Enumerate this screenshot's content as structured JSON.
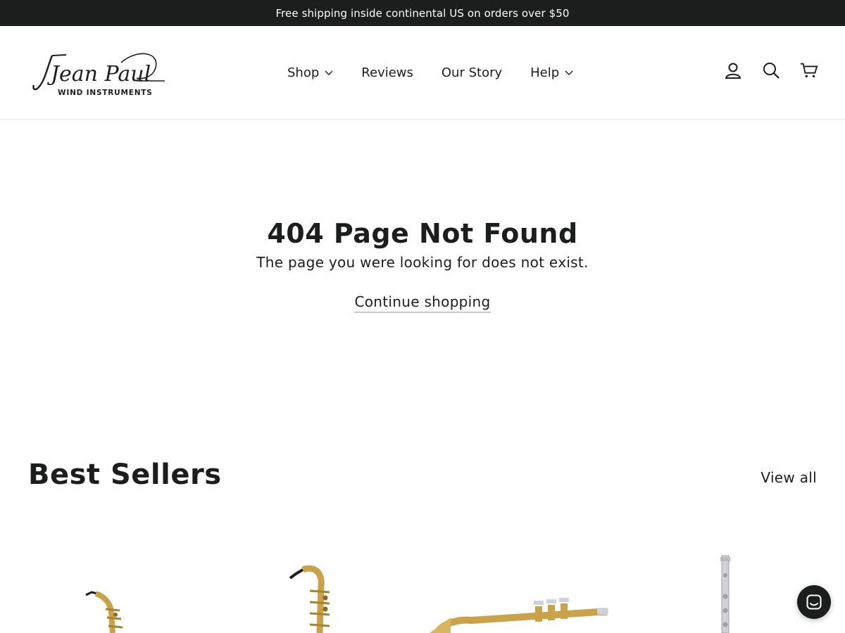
{
  "announcement": {
    "text": "Free shipping inside continental US on orders over $50"
  },
  "brand": {
    "logo_main": "Jean Paul",
    "logo_sub": "WIND INSTRUMENTS"
  },
  "nav": {
    "shop": "Shop",
    "reviews": "Reviews",
    "story": "Our Story",
    "help": "Help"
  },
  "header_icons": {
    "account": "account-icon",
    "search": "search-icon",
    "cart": "cart-icon"
  },
  "header_icon_labels": {
    "login": "Log in",
    "search": "Search",
    "cart": "Cart"
  },
  "not_found": {
    "title": "404 Page Not Found",
    "message": "The page you were looking for does not exist.",
    "cta": "Continue shopping"
  },
  "best_sellers": {
    "title": "Best Sellers",
    "view_all": "View all",
    "products": [
      {
        "icon": "alto-saxophone-image"
      },
      {
        "icon": "tenor-saxophone-image"
      },
      {
        "icon": "trumpet-image"
      },
      {
        "icon": "flute-image"
      }
    ]
  },
  "chat": {
    "icon": "chat-icon"
  },
  "colors": {
    "announcement_bg": "#1c1d1d",
    "text": "#1c1d1d",
    "brass": "#c9a24a",
    "silver": "#cfd2d6"
  }
}
